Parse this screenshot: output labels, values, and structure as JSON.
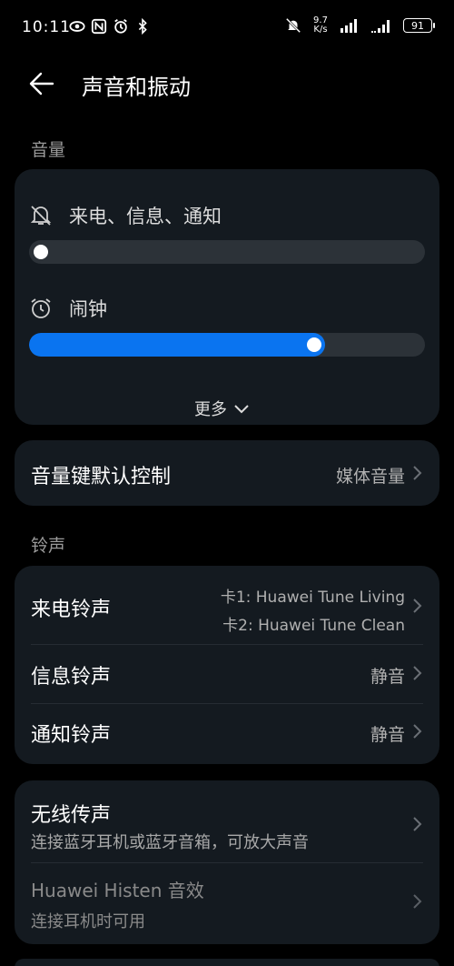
{
  "status_bar": {
    "time": "10:11",
    "net_speed_value": "9.7",
    "net_speed_unit": "K/s",
    "battery": "91"
  },
  "header": {
    "title": "声音和振动"
  },
  "volume_section": {
    "label": "音量",
    "ringer": {
      "label": "来电、信息、通知",
      "level": 0.0
    },
    "alarm": {
      "label": "闹钟",
      "level": 0.73
    },
    "more_label": "更多"
  },
  "volume_key": {
    "title": "音量键默认控制",
    "value": "媒体音量"
  },
  "ringtone_section": {
    "label": "铃声",
    "incoming": {
      "title": "来电铃声",
      "card1": "卡1: Huawei Tune Living",
      "card2": "卡2: Huawei Tune Clean"
    },
    "message": {
      "title": "信息铃声",
      "value": "静音"
    },
    "notification": {
      "title": "通知铃声",
      "value": "静音"
    }
  },
  "wireless": {
    "title": "无线传声",
    "subtitle": "连接蓝牙耳机或蓝牙音箱，可放大声音"
  },
  "histen": {
    "title": "Huawei Histen 音效",
    "subtitle": "连接耳机时可用"
  },
  "colors": {
    "accent": "#0a74f0",
    "card_bg": "#141a20",
    "page_bg": "#000000"
  }
}
